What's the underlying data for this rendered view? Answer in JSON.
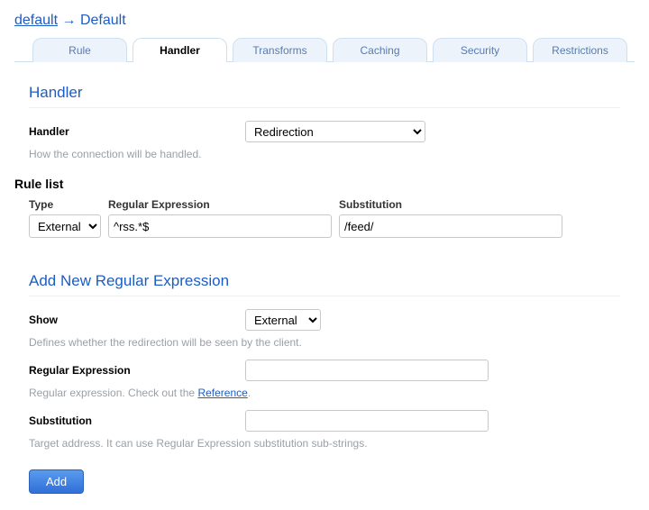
{
  "breadcrumb": {
    "first": "default",
    "second": "Default"
  },
  "tabs": {
    "rule": "Rule",
    "handler": "Handler",
    "transforms": "Transforms",
    "caching": "Caching",
    "security": "Security",
    "restrictions": "Restrictions"
  },
  "handler_section": {
    "title": "Handler",
    "label": "Handler",
    "value": "Redirection",
    "help": "How the connection will be handled."
  },
  "rule_list": {
    "title": "Rule list",
    "type_header": "Type",
    "regex_header": "Regular Expression",
    "sub_header": "Substitution",
    "row": {
      "type": "External",
      "regex": "^rss.*$",
      "sub": "/feed/"
    }
  },
  "add_section": {
    "title": "Add New Regular Expression",
    "show": {
      "label": "Show",
      "value": "External",
      "help": "Defines whether the redirection will be seen by the client."
    },
    "regex": {
      "label": "Regular Expression",
      "help_prefix": "Regular expression. Check out the ",
      "help_link": "Reference",
      "help_suffix": "."
    },
    "sub": {
      "label": "Substitution",
      "help": "Target address. It can use Regular Expression substitution sub-strings."
    },
    "button": "Add"
  }
}
